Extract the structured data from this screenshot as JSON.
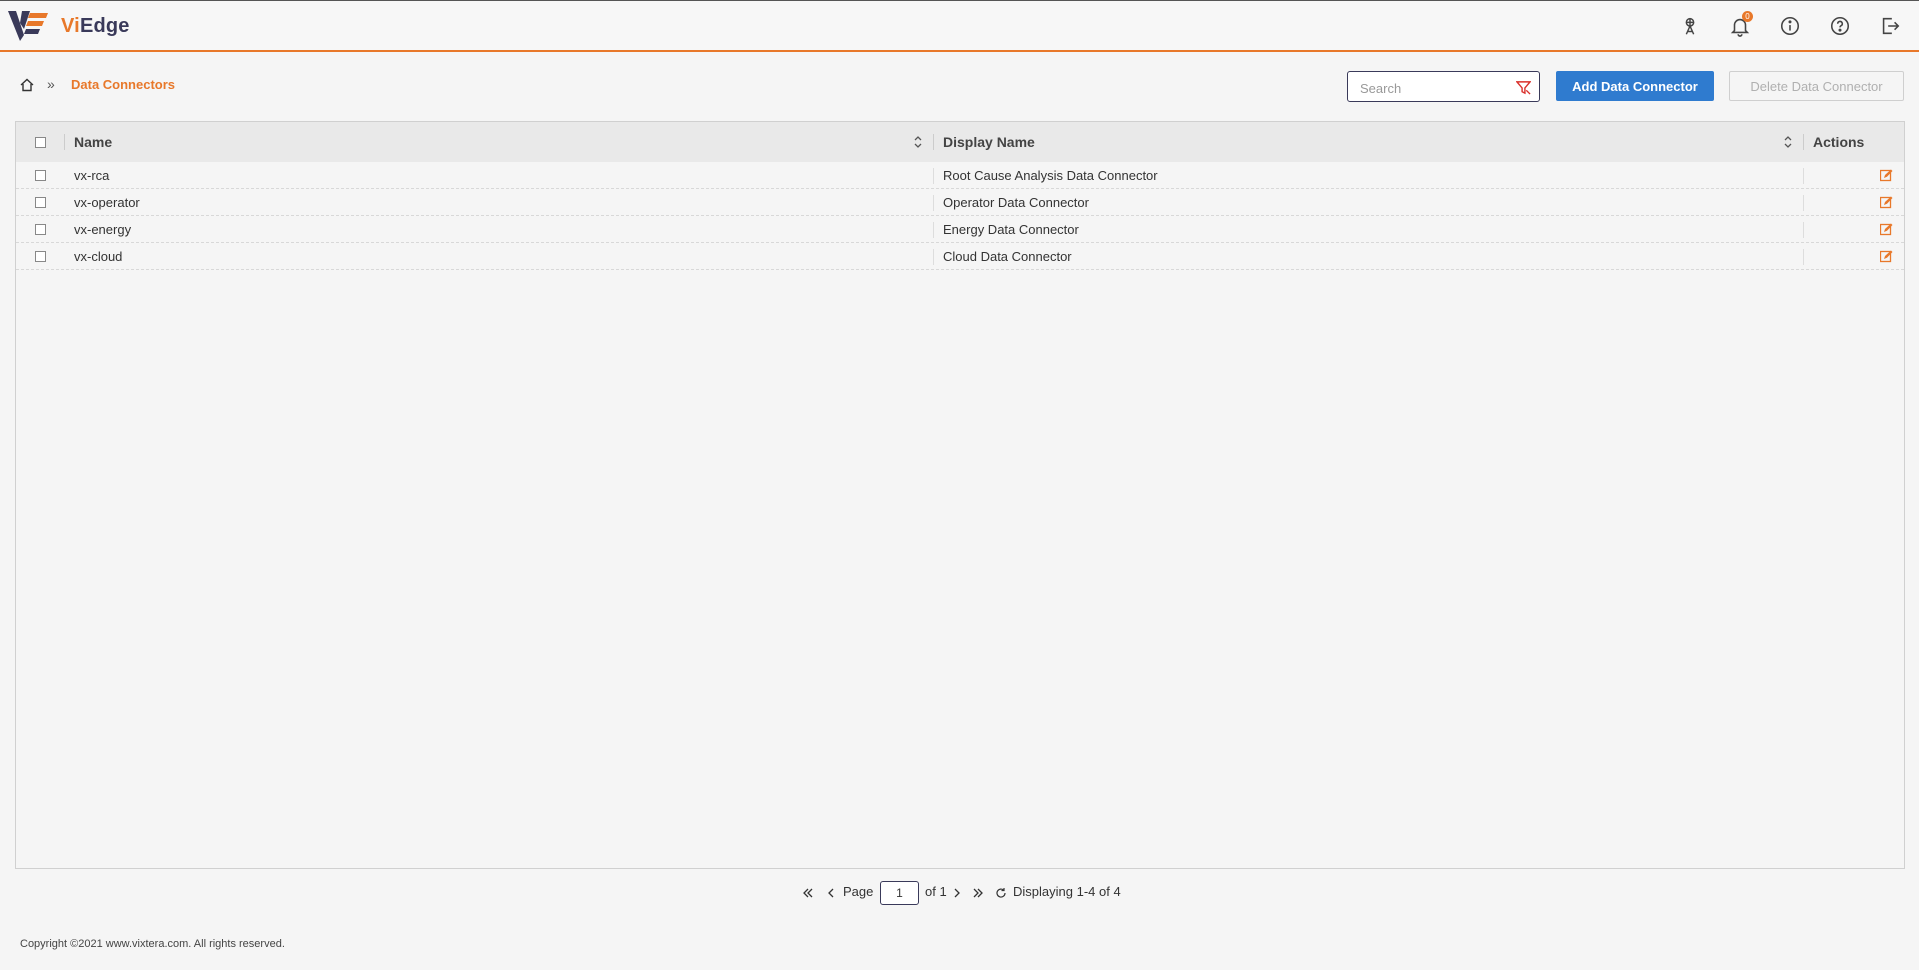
{
  "app": {
    "brand_prefix": "Vi",
    "brand_suffix": "Edge"
  },
  "header": {
    "icons": [
      "satellite-icon",
      "bell-icon",
      "info-icon",
      "help-icon",
      "logout-icon"
    ],
    "notification_count": "0"
  },
  "breadcrumb": {
    "separator": "»",
    "current": "Data Connectors"
  },
  "search": {
    "placeholder": "Search",
    "value": ""
  },
  "toolbar": {
    "add_label": "Add Data Connector",
    "delete_label": "Delete Data Connector"
  },
  "table": {
    "columns": {
      "name": "Name",
      "display_name": "Display Name",
      "actions": "Actions"
    },
    "rows": [
      {
        "name": "vx-rca",
        "display_name": "Root Cause Analysis Data Connector"
      },
      {
        "name": "vx-operator",
        "display_name": "Operator Data Connector"
      },
      {
        "name": "vx-energy",
        "display_name": "Energy Data Connector"
      },
      {
        "name": "vx-cloud",
        "display_name": "Cloud Data Connector"
      }
    ]
  },
  "pager": {
    "page_label": "Page",
    "current_page": "1",
    "of_label": "of 1",
    "display_text": "Displaying 1-4 of 4"
  },
  "footer": {
    "copyright": "Copyright ©2021 www.vixtera.com. All rights reserved."
  },
  "colors": {
    "accent": "#e8782a",
    "primary": "#2f7bcf",
    "brand_dark": "#3a3a5a"
  }
}
